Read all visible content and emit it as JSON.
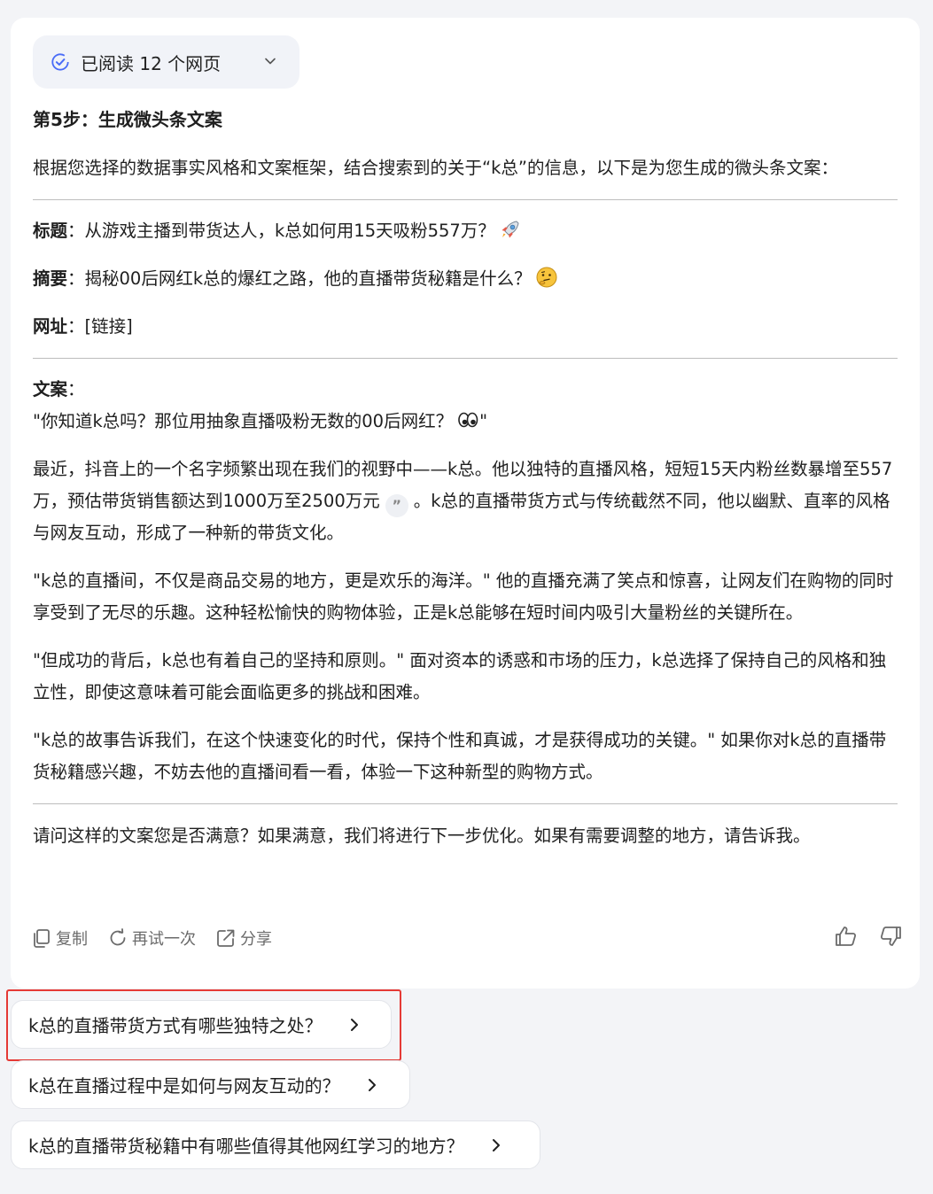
{
  "read_status": {
    "label": "已阅读 12 个网页"
  },
  "step_title": "第5步：生成微头条文案",
  "intro": "根据您选择的数据事实风格和文案框架，结合搜索到的关于“k总”的信息，以下是为您生成的微头条文案：",
  "fields": {
    "title_label": "标题",
    "title_value": "：从游戏主播到带货达人，k总如何用15天吸粉557万？",
    "summary_label": "摘要",
    "summary_value": "：揭秘00后网红k总的爆红之路，他的直播带货秘籍是什么？",
    "url_label": "网址",
    "url_value": "：[链接]",
    "copy_label": "文案",
    "copy_colon": "："
  },
  "paragraphs": {
    "quote": "\"你知道k总吗？那位用抽象直播吸粉无数的00后网红？",
    "quote_end": "\"",
    "p1_a": "最近，抖音上的一个名字频繁出现在我们的视野中——k总。他以独特的直播风格，短短15天内粉丝数暴增至557万，预估带货销售额达到1000万至2500万元",
    "p1_b": "。k总的直播带货方式与传统截然不同，他以幽默、直率的风格与网友互动，形成了一种新的带货文化。",
    "p2": "\"k总的直播间，不仅是商品交易的地方，更是欢乐的海洋。\" 他的直播充满了笑点和惊喜，让网友们在购物的同时享受到了无尽的乐趣。这种轻松愉快的购物体验，正是k总能够在短时间内吸引大量粉丝的关键所在。",
    "p3": "\"但成功的背后，k总也有着自己的坚持和原则。\" 面对资本的诱惑和市场的压力，k总选择了保持自己的风格和独立性，即使这意味着可能会面临更多的挑战和困难。",
    "p4": "\"k总的故事告诉我们，在这个快速变化的时代，保持个性和真诚，才是获得成功的关键。\" 如果你对k总的直播带货秘籍感兴趣，不妨去他的直播间看一看，体验一下这种新型的购物方式。"
  },
  "closing": "请问这样的文案您是否满意？如果满意，我们将进行下一步优化。如果有需要调整的地方，请告诉我。",
  "actions": {
    "copy": "复制",
    "retry": "再试一次",
    "share": "分享"
  },
  "suggestions": [
    {
      "label": "k总的直播带货方式有哪些独特之处？"
    },
    {
      "label": "k总在直播过程中是如何与网友互动的？"
    },
    {
      "label": "k总的直播带货秘籍中有哪些值得其他网红学习的地方？"
    }
  ],
  "colors": {
    "accent": "#4a6cf7",
    "highlight": "#e53935"
  }
}
